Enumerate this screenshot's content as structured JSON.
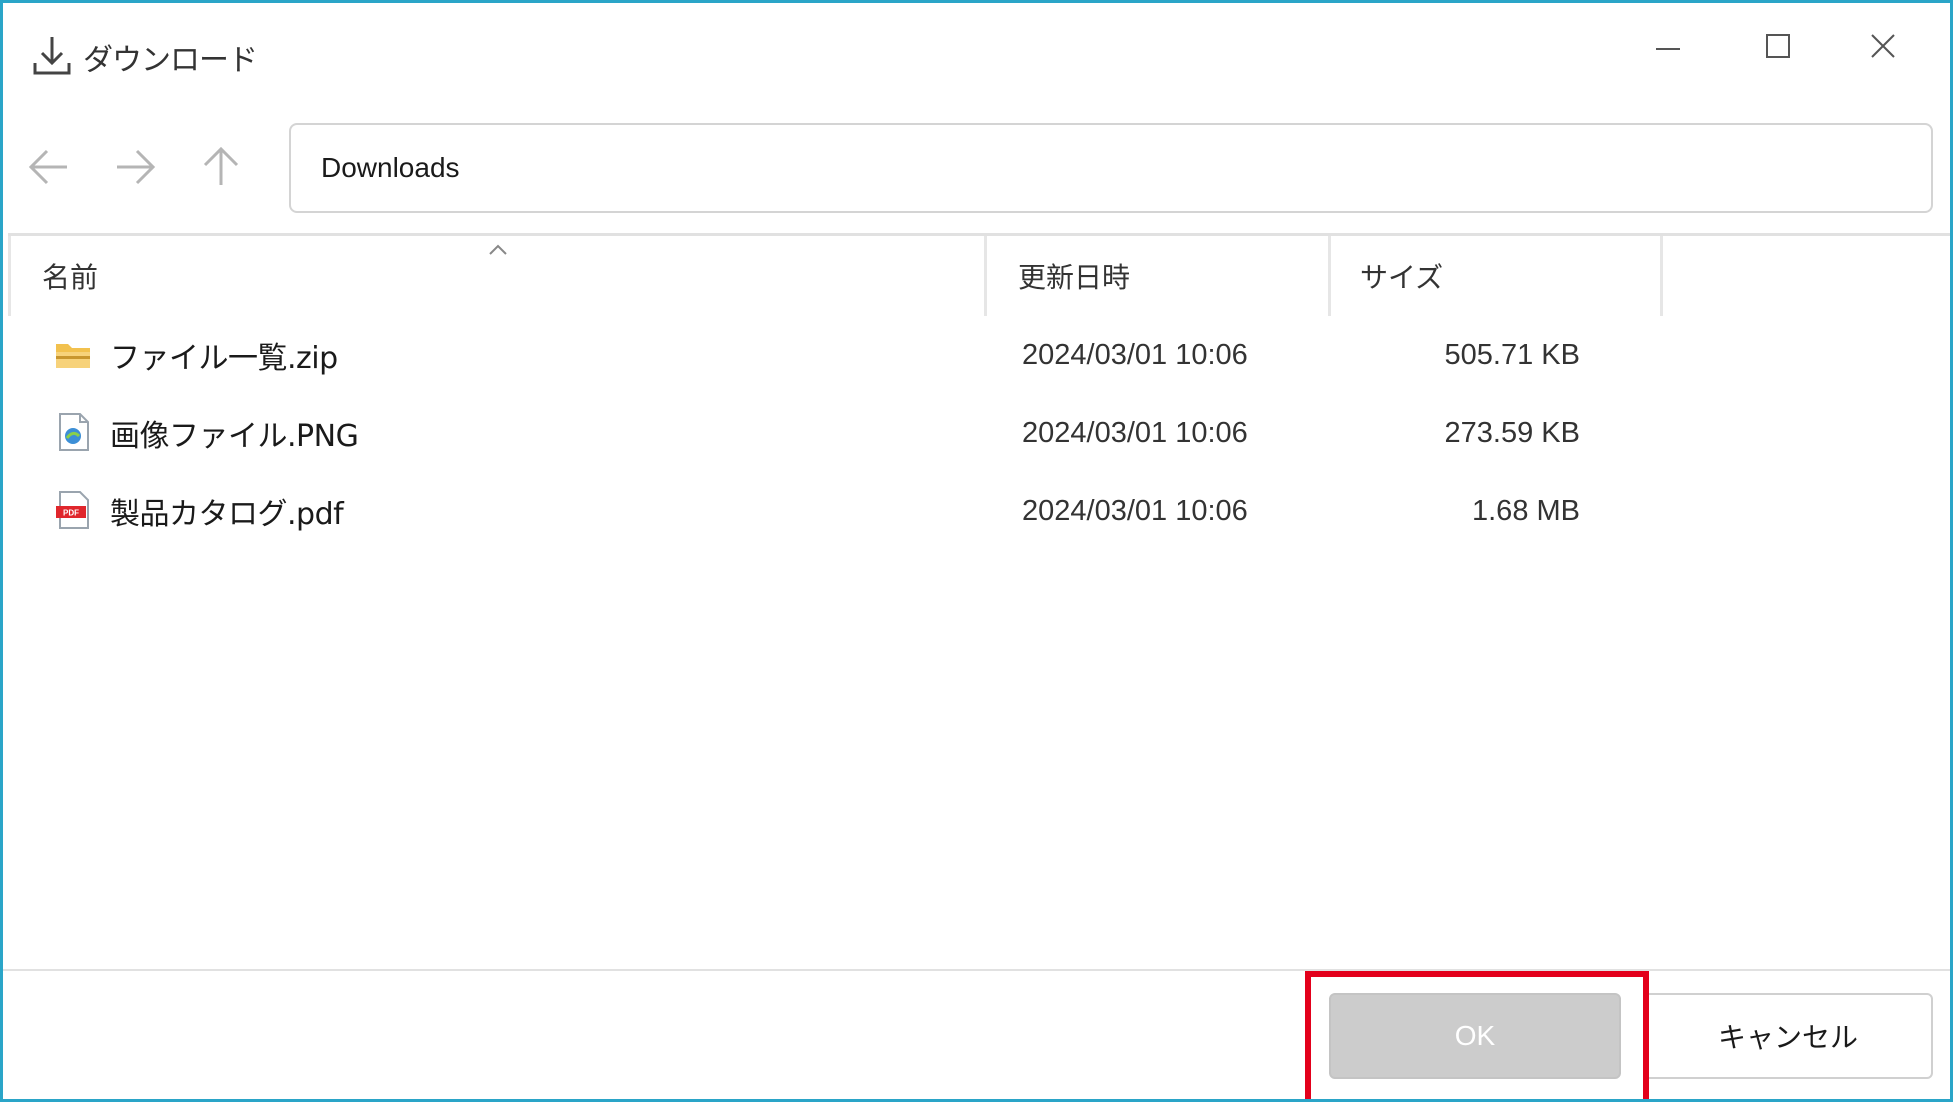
{
  "window": {
    "title": "ダウンロード",
    "frame_color": "#2aa5c8"
  },
  "nav": {
    "back_icon": "arrow-left-icon",
    "forward_icon": "arrow-right-icon",
    "up_icon": "arrow-up-icon",
    "path": "Downloads"
  },
  "columns": {
    "name": "名前",
    "modified": "更新日時",
    "size": "サイズ"
  },
  "files": [
    {
      "name": "ファイル一覧.zip",
      "modified": "2024/03/01 10:06",
      "size": "505.71 KB",
      "icon": "folder-zip-icon"
    },
    {
      "name": "画像ファイル.PNG",
      "modified": "2024/03/01 10:06",
      "size": "273.59 KB",
      "icon": "image-file-icon"
    },
    {
      "name": "製品カタログ.pdf",
      "modified": "2024/03/01 10:06",
      "size": "1.68 MB",
      "icon": "pdf-file-icon"
    }
  ],
  "pdf_badge": "PDF",
  "footer": {
    "ok_label": "OK",
    "cancel_label": "キャンセル",
    "highlight_color": "#e3001b"
  }
}
